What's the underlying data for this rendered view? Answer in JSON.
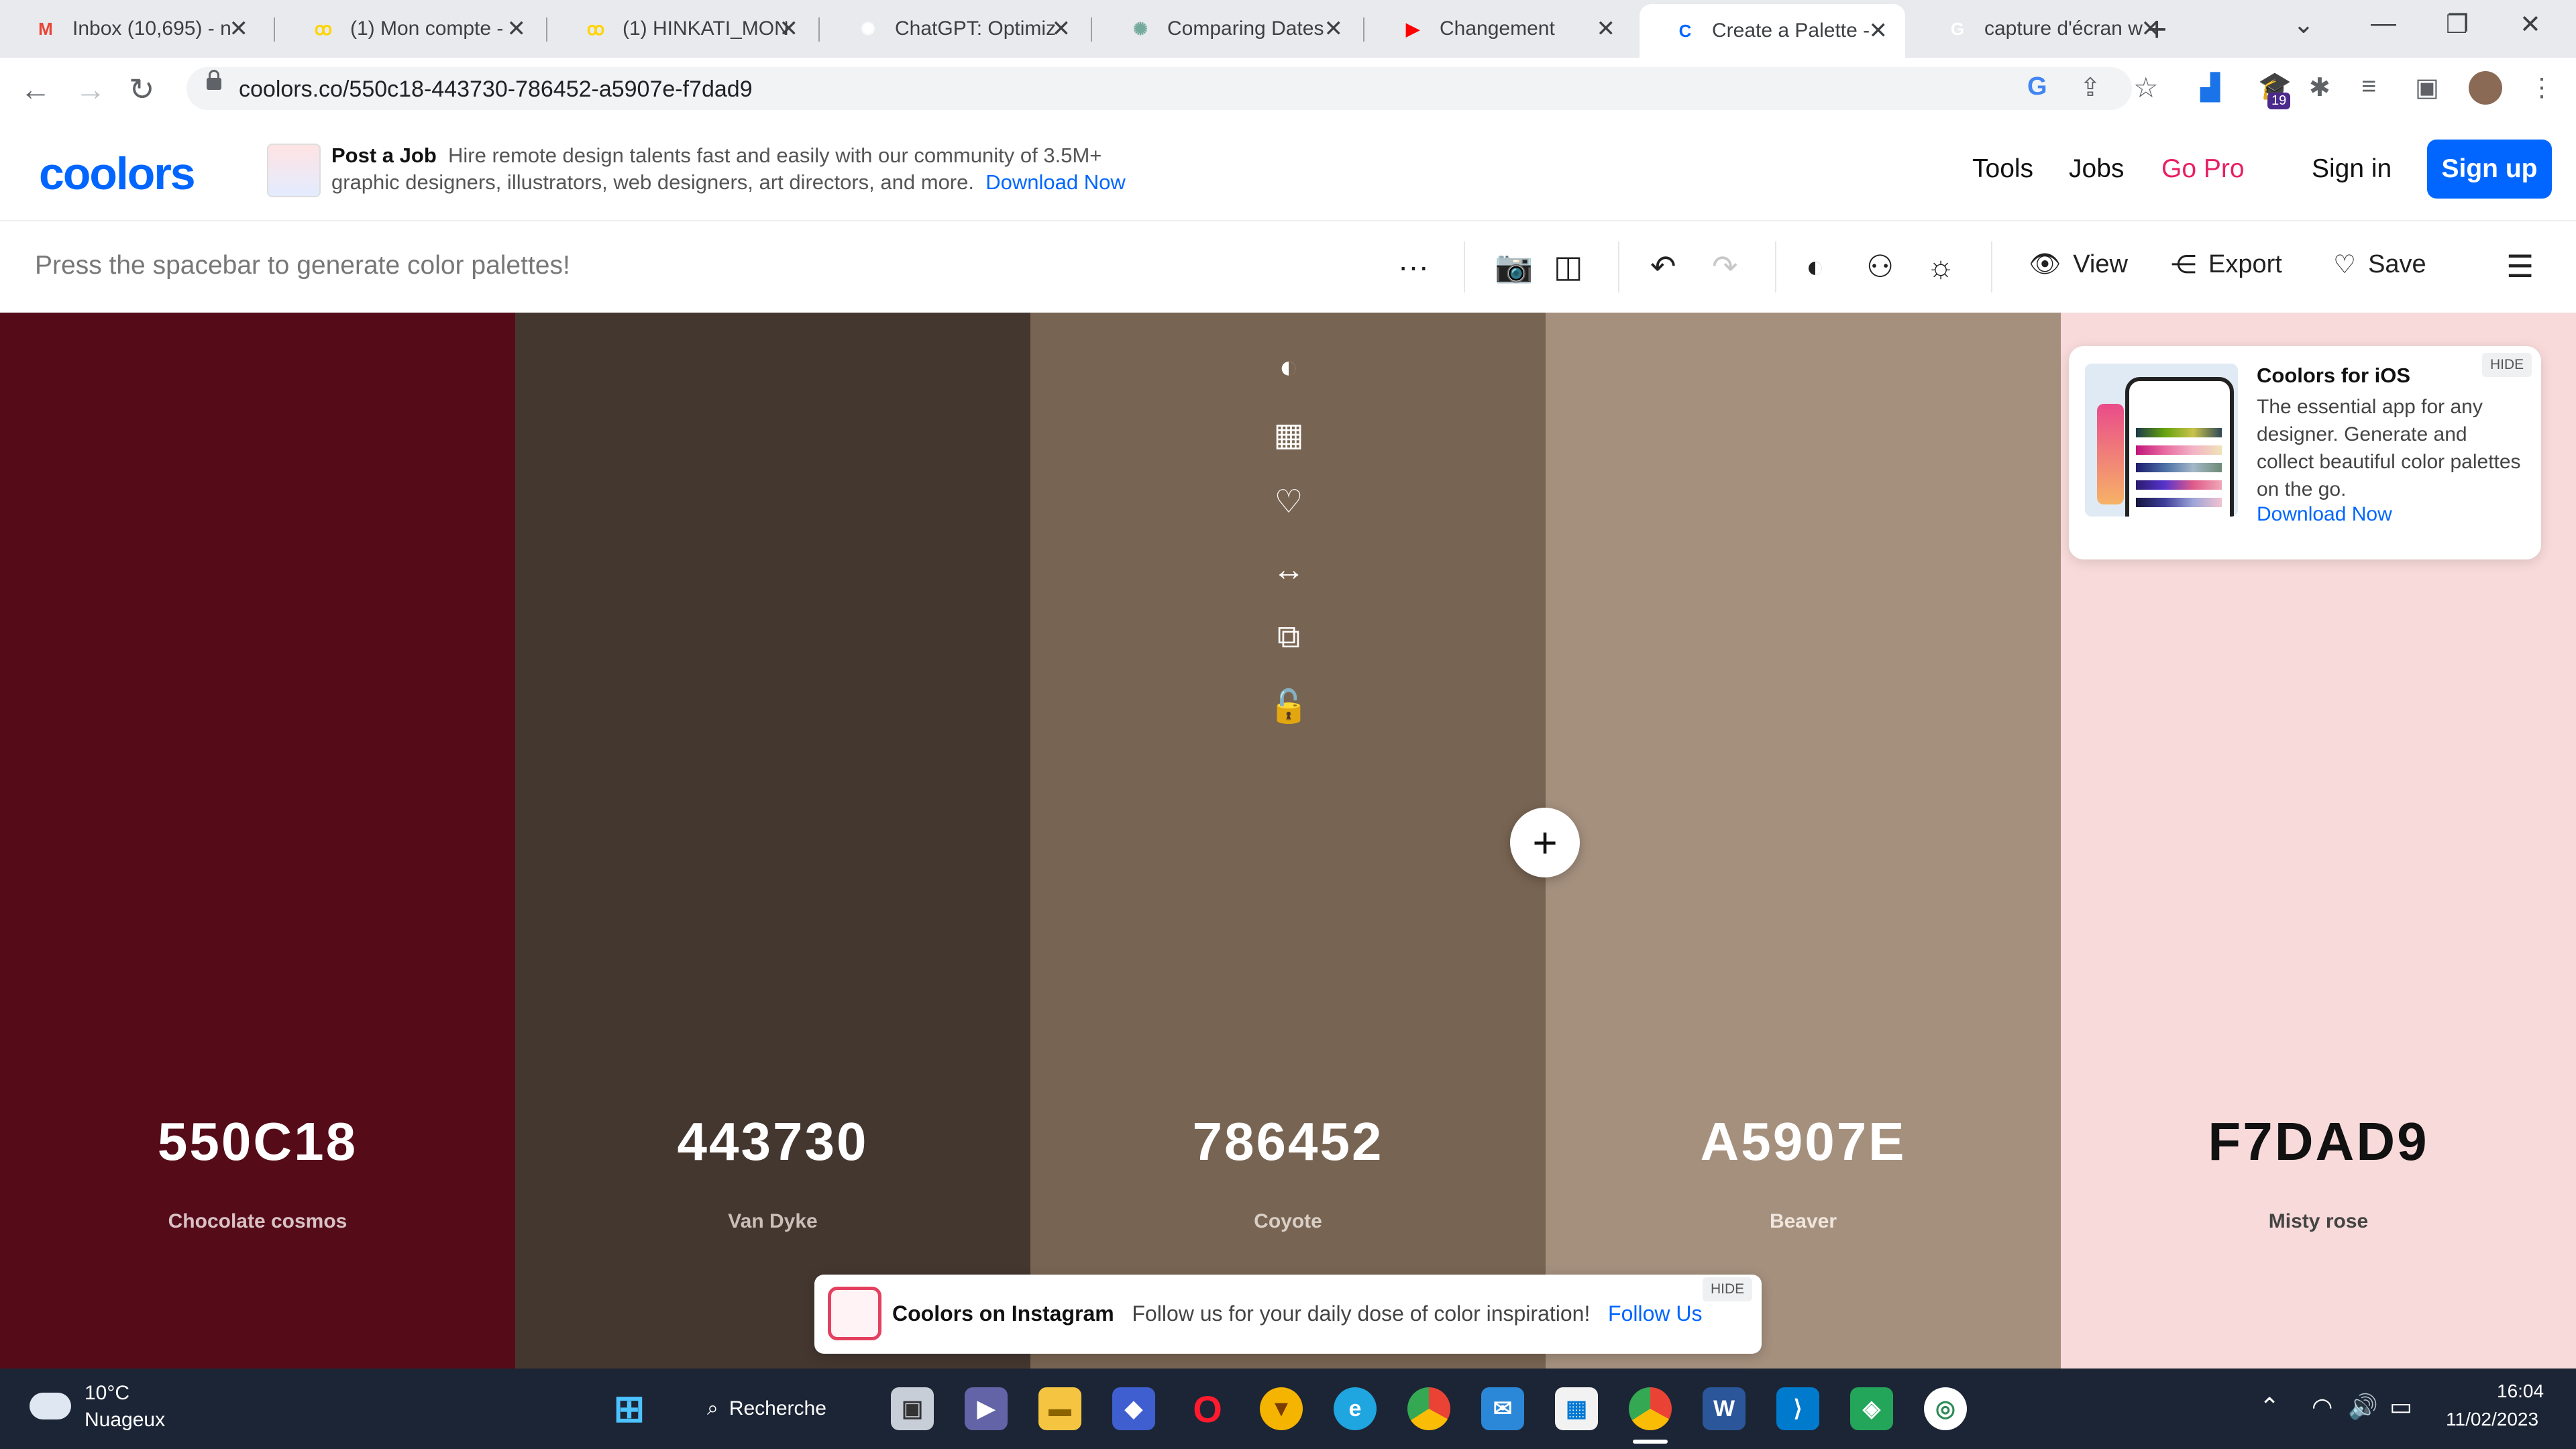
{
  "browser": {
    "tabs": [
      {
        "title": "Inbox (10,695) - n",
        "icon": "gmail-icon",
        "fav_color": "#ea4335",
        "fav_glyph": "M"
      },
      {
        "title": "(1) Mon compte -",
        "icon": "mailbox-icon",
        "fav_color": "#ffd400",
        "fav_glyph": "ꝏ"
      },
      {
        "title": "(1) HINKATI_MON",
        "icon": "mailbox-icon",
        "fav_color": "#ffd400",
        "fav_glyph": "ꝏ"
      },
      {
        "title": "ChatGPT: Optimiz",
        "icon": "openai-icon",
        "fav_color": "#ffffff",
        "fav_glyph": "✺"
      },
      {
        "title": "Comparing Dates",
        "icon": "openai-icon",
        "fav_color": "#74aa9c",
        "fav_glyph": "✺"
      },
      {
        "title": "Changement",
        "icon": "youtube-icon",
        "fav_color": "#ff0000",
        "fav_glyph": "▶"
      },
      {
        "title": "Create a Palette -",
        "icon": "coolors-icon",
        "fav_color": "#0066ff",
        "fav_glyph": "C"
      },
      {
        "title": "capture d'écran w",
        "icon": "google-icon",
        "fav_color": "#ffffff",
        "fav_glyph": "G"
      }
    ],
    "active_tab_index": 6,
    "url": "coolors.co/550c18-443730-786452-a5907e-f7dad9",
    "extension_badge": "19"
  },
  "header": {
    "logo": "coolors",
    "ad_title": "Post a Job",
    "ad_text_1": "Hire remote design talents fast and easily with our community of 3.5M+",
    "ad_text_2": "graphic designers, illustrators, web designers, art directors, and more.",
    "ad_link": "Download Now",
    "nav_tools": "Tools",
    "nav_jobs": "Jobs",
    "nav_gopro": "Go Pro",
    "sign_in": "Sign in",
    "sign_up": "Sign up"
  },
  "toolbar": {
    "hint": "Press the spacebar to generate color palettes!",
    "view": "View",
    "export": "Export",
    "save": "Save"
  },
  "palette": [
    {
      "hex": "550C18",
      "name": "Chocolate cosmos",
      "bg": "#550c18",
      "fg": "#ffffff",
      "sub": "#d9c2c5"
    },
    {
      "hex": "443730",
      "name": "Van Dyke",
      "bg": "#443730",
      "fg": "#ffffff",
      "sub": "#c9bfb8"
    },
    {
      "hex": "786452",
      "name": "Coyote",
      "bg": "#786452",
      "fg": "#ffffff",
      "sub": "#d8cfc6"
    },
    {
      "hex": "A5907E",
      "name": "Beaver",
      "bg": "#a5907e",
      "fg": "#ffffff",
      "sub": "#efe6de"
    },
    {
      "hex": "F7DAD9",
      "name": "Misty rose",
      "bg": "#f7dad9",
      "fg": "#111111",
      "sub": "#444444"
    }
  ],
  "ios_promo": {
    "title": "Coolors for iOS",
    "desc": "The essential app for any designer. Generate and collect beautiful color palettes on the go.",
    "link": "Download Now",
    "hide": "HIDE"
  },
  "insta_promo": {
    "title": "Coolors on Instagram",
    "text": "Follow us for your daily dose of color inspiration!",
    "link": "Follow Us",
    "hide": "HIDE"
  },
  "taskbar": {
    "temp": "10°C",
    "weather": "Nuageux",
    "search": "Recherche",
    "time": "16:04",
    "date": "11/02/2023"
  }
}
